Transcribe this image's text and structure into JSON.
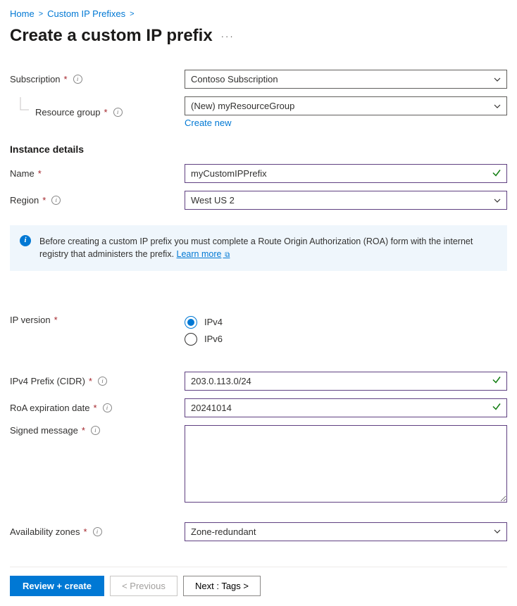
{
  "breadcrumb": {
    "home": "Home",
    "prefixes": "Custom IP Prefixes"
  },
  "page": {
    "title": "Create a custom IP prefix"
  },
  "labels": {
    "subscription": "Subscription",
    "resource_group": "Resource group",
    "create_new": "Create new",
    "name": "Name",
    "region": "Region",
    "ip_version": "IP version",
    "ipv4_prefix": "IPv4 Prefix (CIDR)",
    "roa_date": "RoA expiration date",
    "signed_message": "Signed message",
    "availability_zones": "Availability zones"
  },
  "sections": {
    "instance_details": "Instance details"
  },
  "values": {
    "subscription": "Contoso Subscription",
    "resource_group": "(New) myResourceGroup",
    "name": "myCustomIPPrefix",
    "region": "West US 2",
    "ipv4_prefix": "203.0.113.0/24",
    "roa_date": "20241014",
    "signed_message": "",
    "availability_zones": "Zone-redundant"
  },
  "radio": {
    "ipv4": "IPv4",
    "ipv6": "IPv6",
    "selected": "ipv4"
  },
  "infobox": {
    "text": "Before creating a custom IP prefix you must complete a Route Origin Authorization (ROA) form with the internet registry that administers the prefix. ",
    "learn_more": "Learn more"
  },
  "buttons": {
    "review_create": "Review + create",
    "previous": "< Previous",
    "next": "Next : Tags >"
  }
}
